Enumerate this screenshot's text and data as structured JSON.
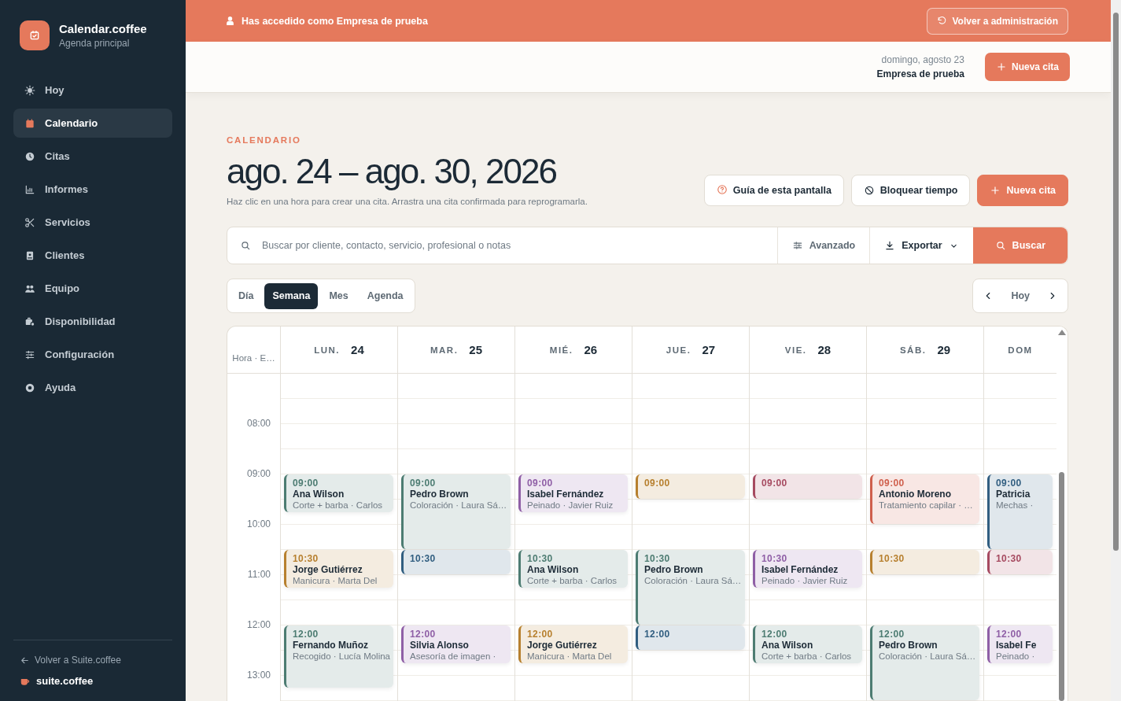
{
  "brand": {
    "name": "Calendar.coffee",
    "subtitle": "Agenda principal"
  },
  "sidebar": {
    "items": [
      {
        "label": "Hoy",
        "selected": false
      },
      {
        "label": "Calendario",
        "selected": true
      },
      {
        "label": "Citas",
        "selected": false
      },
      {
        "label": "Informes",
        "selected": false
      },
      {
        "label": "Servicios",
        "selected": false
      },
      {
        "label": "Clientes",
        "selected": false
      },
      {
        "label": "Equipo",
        "selected": false
      },
      {
        "label": "Disponibilidad",
        "selected": false
      },
      {
        "label": "Configuración",
        "selected": false
      },
      {
        "label": "Ayuda",
        "selected": false
      }
    ]
  },
  "sidebar_footer": {
    "back_link": "Volver a Suite.coffee",
    "suite_brand": "suite.coffee"
  },
  "banner": {
    "text": "Has accedido como Empresa de prueba",
    "button": "Volver a administración"
  },
  "header": {
    "date": "domingo, agosto 23",
    "company": "Empresa de prueba",
    "new_button": "Nueva cita"
  },
  "page": {
    "kicker": "CALENDARIO",
    "title": "ago. 24 – ago. 30, 2026",
    "hint": "Haz clic en una hora para crear una cita. Arrastra una cita confirmada para reprogramarla.",
    "buttons": [
      {
        "label": "Guía de esta pantalla",
        "kind": "help"
      },
      {
        "label": "Bloquear tiempo",
        "kind": "block"
      },
      {
        "label": "Nueva cita",
        "kind": "primary"
      }
    ]
  },
  "search": {
    "placeholder": "Buscar por cliente, contacto, servicio, profesional o notas",
    "advanced": "Avanzado",
    "export": "Exportar",
    "submit": "Buscar"
  },
  "views": [
    {
      "label": "Día",
      "selected": false
    },
    {
      "label": "Semana",
      "selected": true
    },
    {
      "label": "Mes",
      "selected": false
    },
    {
      "label": "Agenda",
      "selected": false
    }
  ],
  "navigation": {
    "today": "Hoy"
  },
  "calendar": {
    "corner": "Hora · E…",
    "hours": [
      "08:00",
      "09:00",
      "10:00",
      "11:00",
      "12:00",
      "13:00"
    ],
    "days": [
      {
        "label": "LUN.",
        "date": "24",
        "events": [
          {
            "time": "09:00",
            "client": "Ana Wilson",
            "service": "Corte + barba · Carlos",
            "color": "#4d7c72",
            "kind": "short"
          },
          {
            "time": "10:30",
            "client": "Jorge Gutiérrez",
            "service": "Manicura · Marta Del",
            "color": "#b7802f",
            "kind": "short"
          },
          {
            "time": "12:00",
            "client": "Fernando Muñoz",
            "service": "Recogido · Lucía Molina",
            "color": "#4d7c72",
            "kind": "medium"
          }
        ]
      },
      {
        "label": "MAR.",
        "date": "25",
        "events": [
          {
            "time": "09:00",
            "client": "Pedro Brown",
            "service": "Coloración · Laura Sá…",
            "color": "#4d7c72",
            "kind": "long"
          },
          {
            "time": "10:30",
            "color": "#315e80",
            "kind": "half"
          },
          {
            "time": "12:00",
            "client": "Silvia Alonso",
            "service": "Asesoría de imagen ·",
            "color": "#8f5fa6",
            "kind": "short"
          }
        ]
      },
      {
        "label": "MIÉ.",
        "date": "26",
        "events": [
          {
            "time": "09:00",
            "client": "Isabel Fernández",
            "service": "Peinado · Javier Ruiz",
            "color": "#8f5fa6",
            "kind": "short"
          },
          {
            "time": "10:30",
            "client": "Ana Wilson",
            "service": "Corte + barba · Carlos",
            "color": "#4d7c72",
            "kind": "short"
          },
          {
            "time": "12:00",
            "client": "Jorge Gutiérrez",
            "service": "Manicura · Marta Del",
            "color": "#b7802f",
            "kind": "short"
          }
        ]
      },
      {
        "label": "JUE.",
        "date": "27",
        "events": [
          {
            "time": "09:00",
            "color": "#b7802f",
            "kind": "half"
          },
          {
            "time": "10:30",
            "client": "Pedro Brown",
            "service": "Coloración · Laura Sá…",
            "color": "#4d7c72",
            "kind": "long"
          },
          {
            "time": "12:00",
            "color": "#315e80",
            "kind": "half"
          }
        ]
      },
      {
        "label": "VIE.",
        "date": "28",
        "events": [
          {
            "time": "09:00",
            "color": "#a64a60",
            "kind": "half"
          },
          {
            "time": "10:30",
            "client": "Isabel Fernández",
            "service": "Peinado · Javier Ruiz",
            "color": "#8f5fa6",
            "kind": "short"
          },
          {
            "time": "12:00",
            "client": "Ana Wilson",
            "service": "Corte + barba · Carlos",
            "color": "#4d7c72",
            "kind": "short"
          }
        ]
      },
      {
        "label": "SÁB.",
        "date": "29",
        "events": [
          {
            "time": "09:00",
            "client": "Antonio Moreno",
            "service": "Tratamiento capilar · …",
            "color": "#cf5f4c",
            "kind": "hour"
          },
          {
            "time": "10:30",
            "color": "#b7802f",
            "kind": "half"
          },
          {
            "time": "12:00",
            "client": "Pedro Brown",
            "service": "Coloración · Laura Sá…",
            "color": "#4d7c72",
            "kind": "long"
          }
        ]
      },
      {
        "label": "DOM",
        "events": [
          {
            "time": "09:00",
            "client": "Patricia",
            "service": "Mechas ·",
            "color": "#315e80",
            "kind": "long"
          },
          {
            "time": "10:30",
            "color": "#a64a60",
            "kind": "half"
          },
          {
            "time": "12:00",
            "client": "Isabel Fe",
            "service": "Peinado ·",
            "color": "#8f5fa6",
            "kind": "short"
          }
        ]
      }
    ]
  }
}
